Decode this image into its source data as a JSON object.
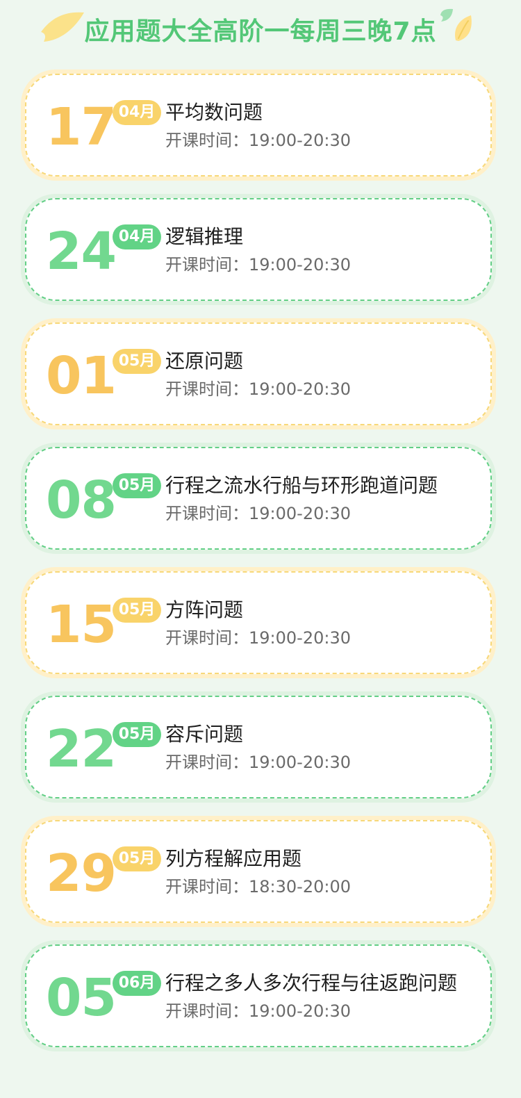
{
  "header": {
    "title": "应用题大全高阶一每周三晚7点"
  },
  "theme": {
    "background": "#eef7ef",
    "green": "#62d386",
    "yellow": "#f9d36a"
  },
  "schedule": {
    "items": [
      {
        "day": "17",
        "month": "04月",
        "title": "平均数问题",
        "time": "开课时间：19:00-20:30",
        "theme": "yellow"
      },
      {
        "day": "24",
        "month": "04月",
        "title": "逻辑推理",
        "time": "开课时间：19:00-20:30",
        "theme": "green"
      },
      {
        "day": "01",
        "month": "05月",
        "title": "还原问题",
        "time": "开课时间：19:00-20:30",
        "theme": "yellow"
      },
      {
        "day": "08",
        "month": "05月",
        "title": "行程之流水行船与环形跑道问题",
        "time": "开课时间：19:00-20:30",
        "theme": "green"
      },
      {
        "day": "15",
        "month": "05月",
        "title": "方阵问题",
        "time": "开课时间：19:00-20:30",
        "theme": "yellow"
      },
      {
        "day": "22",
        "month": "05月",
        "title": "容斥问题",
        "time": "开课时间：19:00-20:30",
        "theme": "green"
      },
      {
        "day": "29",
        "month": "05月",
        "title": "列方程解应用题",
        "time": "开课时间：18:30-20:00",
        "theme": "yellow"
      },
      {
        "day": "05",
        "month": "06月",
        "title": "行程之多人多次行程与往返跑问题",
        "time": "开课时间：19:00-20:30",
        "theme": "green"
      }
    ]
  }
}
